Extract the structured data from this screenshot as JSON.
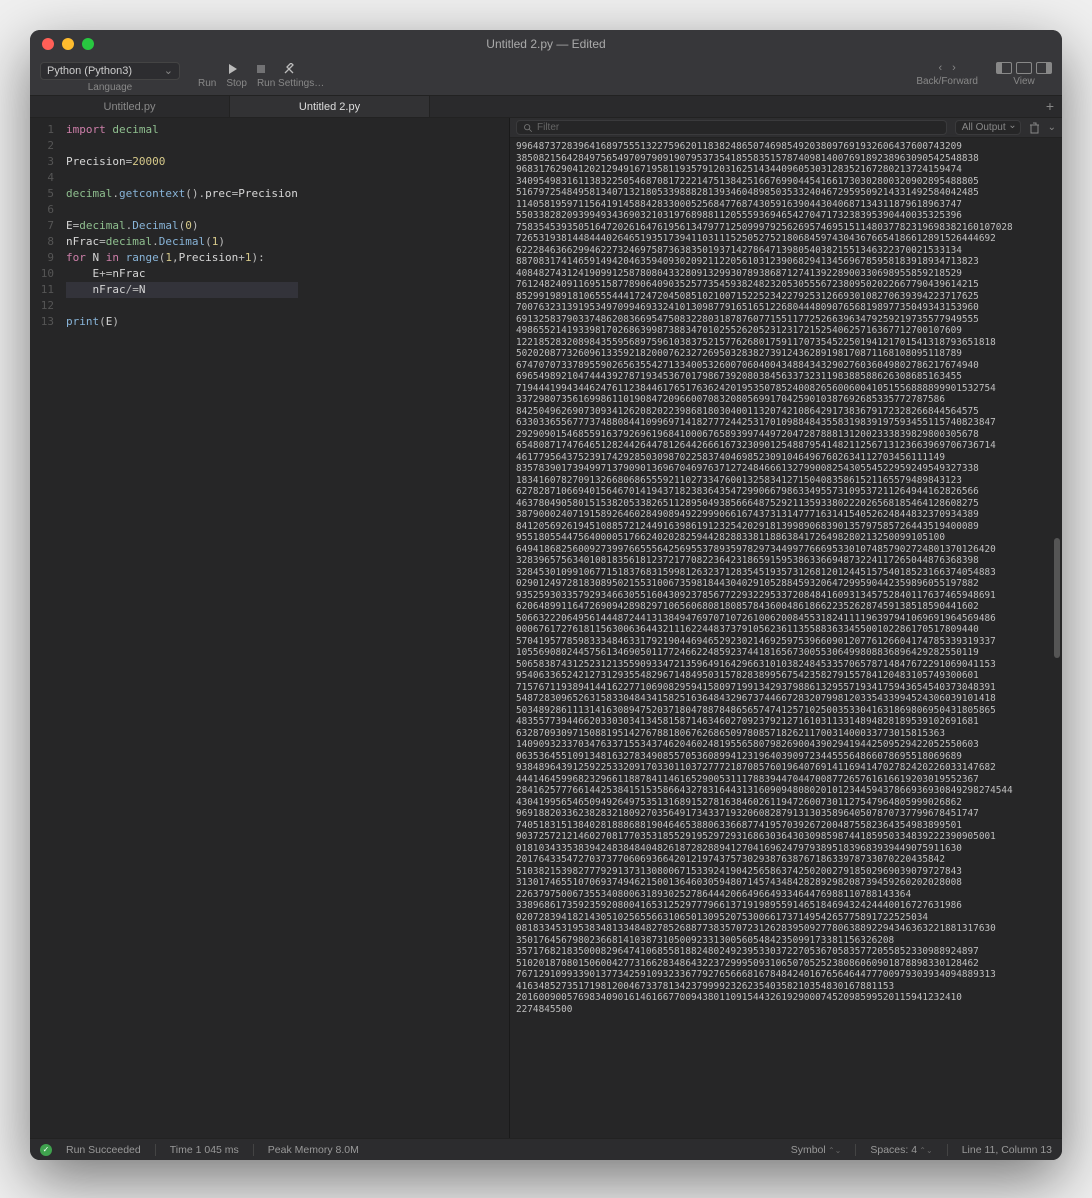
{
  "window": {
    "title": "Untitled 2.py — Edited"
  },
  "toolbar": {
    "language_selected": "Python (Python3)",
    "language_caption": "Language",
    "run_label": "Run",
    "stop_label": "Stop",
    "settings_label": "Run Settings…",
    "backforward_caption": "Back/Forward",
    "view_caption": "View"
  },
  "tabs": {
    "items": [
      "Untitled.py",
      "Untitled 2.py"
    ],
    "active_index": 1
  },
  "editor": {
    "line_numbers": [
      "1",
      "2",
      "3",
      "4",
      "5",
      "6",
      "7",
      "8",
      "9",
      "10",
      "11",
      "12",
      "13"
    ],
    "lines": [
      {
        "tokens": [
          {
            "t": "import",
            "c": "c-kw"
          },
          {
            "t": " ",
            "c": ""
          },
          {
            "t": "decimal",
            "c": "c-mod"
          }
        ]
      },
      {
        "tokens": []
      },
      {
        "tokens": [
          {
            "t": "Precision",
            "c": "c-var"
          },
          {
            "t": "=",
            "c": "c-op"
          },
          {
            "t": "20000",
            "c": "c-num"
          }
        ]
      },
      {
        "tokens": []
      },
      {
        "tokens": [
          {
            "t": "decimal",
            "c": "c-mod"
          },
          {
            "t": ".",
            "c": "c-op"
          },
          {
            "t": "getcontext",
            "c": "c-fn"
          },
          {
            "t": "().",
            "c": "c-op"
          },
          {
            "t": "prec",
            "c": "c-var"
          },
          {
            "t": "=",
            "c": "c-op"
          },
          {
            "t": "Precision",
            "c": "c-var"
          }
        ]
      },
      {
        "tokens": []
      },
      {
        "tokens": [
          {
            "t": "E",
            "c": "c-var"
          },
          {
            "t": "=",
            "c": "c-op"
          },
          {
            "t": "decimal",
            "c": "c-mod"
          },
          {
            "t": ".",
            "c": "c-op"
          },
          {
            "t": "Decimal",
            "c": "c-fn"
          },
          {
            "t": "(",
            "c": "c-op"
          },
          {
            "t": "0",
            "c": "c-num"
          },
          {
            "t": ")",
            "c": "c-op"
          }
        ]
      },
      {
        "tokens": [
          {
            "t": "nFrac",
            "c": "c-var"
          },
          {
            "t": "=",
            "c": "c-op"
          },
          {
            "t": "decimal",
            "c": "c-mod"
          },
          {
            "t": ".",
            "c": "c-op"
          },
          {
            "t": "Decimal",
            "c": "c-fn"
          },
          {
            "t": "(",
            "c": "c-op"
          },
          {
            "t": "1",
            "c": "c-num"
          },
          {
            "t": ")",
            "c": "c-op"
          }
        ]
      },
      {
        "tokens": [
          {
            "t": "for",
            "c": "c-kw"
          },
          {
            "t": " ",
            "c": ""
          },
          {
            "t": "N",
            "c": "c-var"
          },
          {
            "t": " ",
            "c": ""
          },
          {
            "t": "in",
            "c": "c-kw"
          },
          {
            "t": " ",
            "c": ""
          },
          {
            "t": "range",
            "c": "c-fn"
          },
          {
            "t": "(",
            "c": "c-op"
          },
          {
            "t": "1",
            "c": "c-num"
          },
          {
            "t": ",",
            "c": "c-op"
          },
          {
            "t": "Precision",
            "c": "c-var"
          },
          {
            "t": "+",
            "c": "c-op"
          },
          {
            "t": "1",
            "c": "c-num"
          },
          {
            "t": "):",
            "c": "c-op"
          }
        ]
      },
      {
        "tokens": [
          {
            "t": "    ",
            "c": ""
          },
          {
            "t": "E",
            "c": "c-var"
          },
          {
            "t": "+=",
            "c": "c-op"
          },
          {
            "t": "nFrac",
            "c": "c-var"
          }
        ]
      },
      {
        "tokens": [
          {
            "t": "    ",
            "c": ""
          },
          {
            "t": "nFrac",
            "c": "c-var"
          },
          {
            "t": "/=",
            "c": "c-op"
          },
          {
            "t": "N",
            "c": "c-var"
          }
        ],
        "highlight": true
      },
      {
        "tokens": []
      },
      {
        "tokens": [
          {
            "t": "print",
            "c": "c-fn"
          },
          {
            "t": "(",
            "c": "c-op"
          },
          {
            "t": "E",
            "c": "c-var"
          },
          {
            "t": ")",
            "c": "c-op"
          }
        ]
      }
    ]
  },
  "output_toolbar": {
    "filter_placeholder": "Filter",
    "dropdown_label": "All Output"
  },
  "output": {
    "lines": [
      "9964873728396416897555132275962011838248650746985492038097691932606437600743209",
      "3850821564284975654970979091907953735418558351578740981400769189238963090542548838",
      "9683176290412021294916719581193579120316251434409605303128352167280213724159474",
      "3409549831611383225054687081722214751384251667699044541661730302800320902895488805",
      "5167972548495813407132180533988828139346048985035332404672959509214331492584042485",
      "1140581959711564191458842833000525684776874305916390443040687134311879618963747",
      "5503382820939949343690321031976898811205559369465427047173238395390440035325396",
      "7583545393505164720261647619561347977125099979256269574695151148037782319698382160107028",
      "7265319381448444026465193517394110311152505275218068459743043676654186612891526444692",
      "6222846366299462273246975873638350193714278647139805403821551346322370021533134",
      "8870831741465914942046359409302092112205610312390682941345696785958183918934713823",
      "4084827431241909912587808043328091329930789386871274139228900330698955859218529",
      "7612482409116951587789064090352577354593824823205305556723809502022667790439614215",
      "8529919891810655544417247204508510210071522523422792531266930108270639394223717625",
      "7007632313919534970994693324101309877916516512268044480907656819897735049343153960",
      "6913258379033748620836695475083228031878760771551177252663963479259219735577949555",
      "4986552141933981702686399873883470102552620523123172152540625716367712700107609",
      "1221852832089843559568975961038375215776268017591170735452250194121701541318793651818",
      "5020208773260961335921820007623272695032838273912436289198170871168108095118789",
      "6747070733789559026563554271334005326007060400434884343290276036049802786217674940",
      "6965498921047444392787193453670179867392080384563373231198388588626308685163455",
      "7194441994344624761123844617651763624201953507852400826560060041051556888899901532754",
      "3372980735616998611019084720966007083208056991704259010387692685335772787586",
      "8425049626907309341262082022398681803040011320742108642917383679172328266844564575",
      "6330336556777374880844109969714182777244253170109884843558319839197593455115740823847",
      "2929090154685591637926961968410006765893997449720472878881312002333839829800305678",
      "6548087174764651282442644781264426661673230901254887954148211256713123663969706736714",
      "4617795643752391742928503098702258374046985230910464967602634112703456111149",
      "8357839017394997137909013696704697637127248466613279900825430554522959249549327338",
      "1834160782709132668068655592110273347600132583412715040835861521165579489843123",
      "6278287106694015646701419437182383643547299066798633495573109537211264944162826566",
      "4637804905801515382053382651128950493856664875292113593380222026568185464128608275",
      "3879000240719158926460284908949229990661674373131477716314154052624844832370934389",
      "8412056926194510885721244916398619123254202918139989068390135797585726443519400089",
      "9551805544756400005176624020282594428288338118863841726498280213250099105100",
      "6494186825600927399766555642569553789359782973449977666953301074857902724801370126420",
      "3283965756340108183561812372177082236423186591595386336694873224117265044876368398",
      "3284530109910677151837683159981263237128354519357312681201244515754018523166374054883",
      "0290124972818308950215531006735981844304029105288459320647299590442359896055197882",
      "9352593033579293466305516043092378567722932295337208484160931345752840117637465948691",
      "6206489911647269094289829710656068081808578436004861866223526287459138518590441602",
      "5066322206495614448724413138494769707107261006200845531824111196397941069691964569486",
      "0006761727618115630063644321116224483737910562361135588363345500102286170517809440",
      "5704195778598333484633179219044694652923021469259753966090120776126604174785339319337",
      "1055690802445756134690501177246622485923744181656730055306499808836896429282550119",
      "5065838743125231213559093347213596491642966310103824845335706578714847672291069041153",
      "9540633652421273129355482967148495031578283899567542358279155784120483105749300601",
      "7157671193894144162277106908295941580971991342937988613295571934175943654540373048391",
      "5487283096526315833048434158251636484329673744667283207998120335433994524306039101418",
      "5034892861113141630894752037180478878486565747412571025003533041631869806950431805865",
      "4835577394466203303034134581587146346027092379212716103113314894828189539102691681",
      "6328709309715088195142767881806762686509780857182621170031400033773015815363",
      "1409093233703476337155343746204602481955658079826900439029419442509529422052550603",
      "0635364551091348163278349085570536089941231964039097234455564866078695518069689",
      "9384896439125922533209170330110372777218708576019640769141169414702782420226033147682",
      "4441464599682329661188784114616529005311178839447044700877265761616619203019552367",
      "2841625777661442538415153586643278316443131609094808020101234459437866936930849298274544",
      "4304199565465094926497535131689152781638460261194726007301127547964805999026862",
      "9691882033623828321809270356491734337193206082879131303589640507870737799678451747",
      "7405183151384028188868819046465388063366877419570392672004875582364354983899501",
      "9037257212146027081770353185529195297293168630364303098598744185950334839222390905001",
      "0181034335383942483848404826187282889412704169624797938951839683939449075911630",
      "2017643354727037377060693664201219743757302938763876718633978733070220435842",
      "5103821539827779291373130800671533924190425658637425020027918502969039079727843",
      "3130174655107069374946215001364603059480714574348428289298208739459260202028008",
      "2263797500673553408006318930252786444206649664933464476988110788143364",
      "3389686173592359208004165312529777966137191989559146518469432424440016727631986",
      "0207283941821430510256556631065013095207530066173714954265775891722525034",
      "0818334531953834813348482785268877383570723126283950927780638892294346363221881317630",
      "3501764567980236681410387310500923313005605484235099173381156326208",
      "3571768218350008296474106855818824802492395330372270536705835772055852330988924897",
      "5102018708015060042773166283486432237299950931065070525238086060901878898330128462",
      "7671291099339013773425910932336779276566681678484240167656464477700979303934094889313",
      "4163485273517198120046733781342379999232623540358210354830167881153",
      "2016009005769834090161461667700943801109154432619290007452098599520115941232410",
      "2274845500"
    ]
  },
  "status": {
    "run_label": "Run Succeeded",
    "time_label": "Time 1 045 ms",
    "mem_label": "Peak Memory 8.0M",
    "symbol_label": "Symbol",
    "spaces_label": "Spaces: 4",
    "cursor_label": "Line 11, Column 13"
  }
}
